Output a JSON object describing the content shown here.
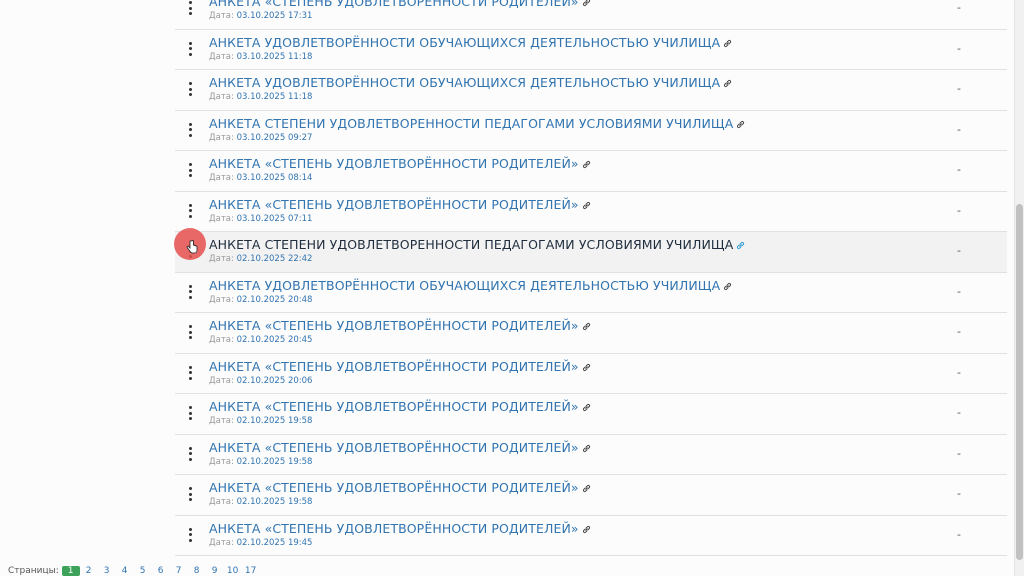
{
  "rows": [
    {
      "title": "АНКЕТА «СТЕПЕНЬ УДОВЛЕТВОРЁННОСТИ РОДИТЕЛЕЙ»",
      "date_label": "Дата:",
      "date": "03.10.2025 17:31",
      "value": "-"
    },
    {
      "title": "АНКЕТА УДОВЛЕТВОРЁННОСТИ ОБУЧАЮЩИХСЯ ДЕЯТЕЛЬНОСТЬЮ УЧИЛИЩА",
      "date_label": "Дата:",
      "date": "03.10.2025 11:18",
      "value": "-"
    },
    {
      "title": "АНКЕТА УДОВЛЕТВОРЁННОСТИ ОБУЧАЮЩИХСЯ ДЕЯТЕЛЬНОСТЬЮ УЧИЛИЩА",
      "date_label": "Дата:",
      "date": "03.10.2025 11:18",
      "value": "-"
    },
    {
      "title": "АНКЕТА СТЕПЕНИ УДОВЛЕТВОРЕННОСТИ ПЕДАГОГАМИ УСЛОВИЯМИ УЧИЛИЩА",
      "date_label": "Дата:",
      "date": "03.10.2025 09:27",
      "value": "-"
    },
    {
      "title": "АНКЕТА «СТЕПЕНЬ УДОВЛЕТВОРЁННОСТИ РОДИТЕЛЕЙ»",
      "date_label": "Дата:",
      "date": "03.10.2025 08:14",
      "value": "-"
    },
    {
      "title": "АНКЕТА «СТЕПЕНЬ УДОВЛЕТВОРЁННОСТИ РОДИТЕЛЕЙ»",
      "date_label": "Дата:",
      "date": "03.10.2025 07:11",
      "value": "-"
    },
    {
      "title": "АНКЕТА СТЕПЕНИ УДОВЛЕТВОРЕННОСТИ ПЕДАГОГАМИ УСЛОВИЯМИ УЧИЛИЩА",
      "date_label": "Дата:",
      "date": "02.10.2025 22:42",
      "value": "-"
    },
    {
      "title": "АНКЕТА УДОВЛЕТВОРЁННОСТИ ОБУЧАЮЩИХСЯ ДЕЯТЕЛЬНОСТЬЮ УЧИЛИЩА",
      "date_label": "Дата:",
      "date": "02.10.2025 20:48",
      "value": "-"
    },
    {
      "title": "АНКЕТА «СТЕПЕНЬ УДОВЛЕТВОРЁННОСТИ РОДИТЕЛЕЙ»",
      "date_label": "Дата:",
      "date": "02.10.2025 20:45",
      "value": "-"
    },
    {
      "title": "АНКЕТА «СТЕПЕНЬ УДОВЛЕТВОРЁННОСТИ РОДИТЕЛЕЙ»",
      "date_label": "Дата:",
      "date": "02.10.2025 20:06",
      "value": "-"
    },
    {
      "title": "АНКЕТА «СТЕПЕНЬ УДОВЛЕТВОРЁННОСТИ РОДИТЕЛЕЙ»",
      "date_label": "Дата:",
      "date": "02.10.2025 19:58",
      "value": "-"
    },
    {
      "title": "АНКЕТА «СТЕПЕНЬ УДОВЛЕТВОРЁННОСТИ РОДИТЕЛЕЙ»",
      "date_label": "Дата:",
      "date": "02.10.2025 19:58",
      "value": "-"
    },
    {
      "title": "АНКЕТА «СТЕПЕНЬ УДОВЛЕТВОРЁННОСТИ РОДИТЕЛЕЙ»",
      "date_label": "Дата:",
      "date": "02.10.2025 19:58",
      "value": "-"
    },
    {
      "title": "АНКЕТА «СТЕПЕНЬ УДОВЛЕТВОРЁННОСТИ РОДИТЕЛЕЙ»",
      "date_label": "Дата:",
      "date": "02.10.2025 19:45",
      "value": "-"
    }
  ],
  "pagination": {
    "label": "Страницы:",
    "pages": [
      "1",
      "2",
      "3",
      "4",
      "5",
      "6",
      "7",
      "8",
      "9",
      "10",
      "17"
    ],
    "current": "1"
  },
  "icons": {
    "row_menu": "vertical-dots-icon",
    "title_link": "link-icon",
    "cursor": "hand-pointer-icon"
  },
  "colors": {
    "link": "#3174b0",
    "active_page": "#3ea35a",
    "cursor_highlight": "#e65050"
  }
}
